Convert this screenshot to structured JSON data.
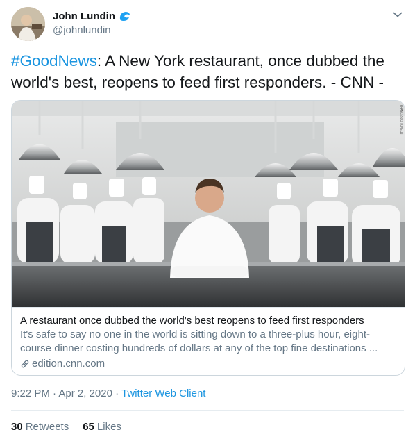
{
  "user": {
    "display_name": "John Lundin",
    "handle": "@johnlundin"
  },
  "tweet": {
    "hashtag": "#GoodNews",
    "text": ": A New York restaurant, once dubbed the world's best, reopens to feed first responders. - CNN -"
  },
  "card": {
    "title": "A restaurant once dubbed the world's best reopens to feed first responders",
    "description": "It's safe to say no one in the world is sitting down to a three-plus hour, eight-course dinner costing hundreds of dollars at any of the top fine destinations ...",
    "domain": "edition.cnn.com",
    "image_credit": "FRANCESCO TONELLI"
  },
  "meta": {
    "time": "9:22 PM",
    "separator": "·",
    "date": "Apr 2, 2020",
    "client": "Twitter Web Client"
  },
  "stats": {
    "retweets_count": "30",
    "retweets_label": "Retweets",
    "likes_count": "65",
    "likes_label": "Likes"
  },
  "icons": {
    "badge": "wave-badge-icon",
    "caret": "chevron-down-icon",
    "link": "link-icon"
  },
  "colors": {
    "link_blue": "#1b95e0",
    "text": "#14171a",
    "secondary": "#657786",
    "border": "#ccd6dd"
  }
}
